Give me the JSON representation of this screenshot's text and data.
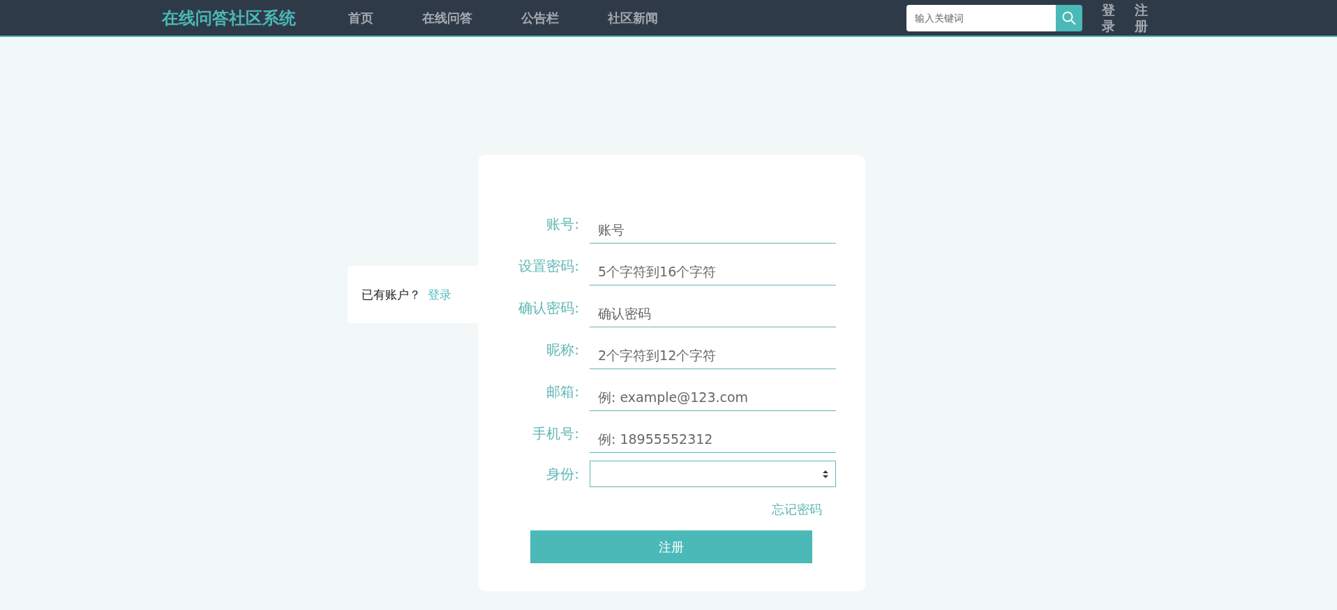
{
  "header": {
    "logo": "在线问答社区系统",
    "nav": [
      {
        "label": "首页"
      },
      {
        "label": "在线问答"
      },
      {
        "label": "公告栏"
      },
      {
        "label": "社区新闻"
      }
    ],
    "search": {
      "placeholder": "输入关键词"
    },
    "auth": [
      "登录",
      "注册"
    ]
  },
  "side": {
    "text": "已有账户？",
    "link": "登录"
  },
  "form": {
    "fields": [
      {
        "kind": "text",
        "label": "账号:",
        "placeholder": "账号"
      },
      {
        "kind": "text",
        "label": "设置密码:",
        "placeholder": "5个字符到16个字符"
      },
      {
        "kind": "text",
        "label": "确认密码:",
        "placeholder": "确认密码"
      },
      {
        "kind": "text",
        "label": "昵称:",
        "placeholder": "2个字符到12个字符"
      },
      {
        "kind": "text",
        "label": "邮箱:",
        "placeholder": "例: example@123.com"
      },
      {
        "kind": "text",
        "label": "手机号:",
        "placeholder": "例: 18955552312"
      },
      {
        "kind": "select",
        "label": "身份:"
      }
    ],
    "forgot": "忘记密码",
    "submit": "注册"
  }
}
